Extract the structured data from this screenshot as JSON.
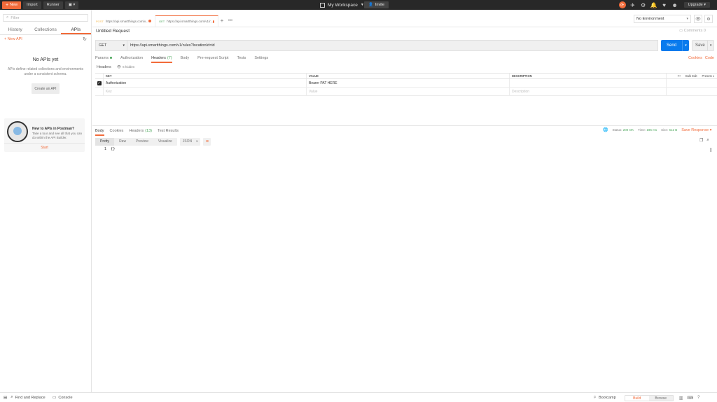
{
  "topbar": {
    "new_label": "New",
    "import_label": "Import",
    "runner_label": "Runner",
    "workspace_label": "My Workspace",
    "invite_label": "Invite",
    "upgrade_label": "Upgrade"
  },
  "sidebar": {
    "filter_placeholder": "Filter",
    "tabs": [
      "History",
      "Collections",
      "APIs"
    ],
    "new_api_label": "+ New API",
    "empty_title": "No APIs yet",
    "empty_desc": "APIs define related collections and environments under a consistent schema.",
    "create_label": "Create an API",
    "promo_title": "New to APIs in Postman?",
    "promo_desc": "Take a tour and see all that you can do within the API Builder.",
    "promo_start": "Start"
  },
  "tabs": [
    {
      "method": "POST",
      "url": "https://api.smartthings.com/v..."
    },
    {
      "method": "GET",
      "url": "https://api.smartthings.com/v1/r..."
    }
  ],
  "environment": {
    "selected": "No Environment"
  },
  "request": {
    "title": "Untitled Request",
    "comments_label": "Comments 0",
    "method": "GET",
    "url": "https://api.smartthings.com/v1/rules?locationId=id",
    "send_label": "Send",
    "save_label": "Save",
    "tabs": {
      "params": "Params",
      "authorization": "Authorization",
      "headers": "Headers",
      "headers_count": "(7)",
      "body": "Body",
      "prerequest": "Pre-request Script",
      "tests": "Tests",
      "settings": "Settings"
    },
    "cookies_link": "Cookies",
    "code_link": "Code",
    "headers_sub": "Headers",
    "hidden_label": "6 hidden",
    "table": {
      "col_key": "KEY",
      "col_value": "VALUE",
      "col_desc": "DESCRIPTION",
      "bulk_edit": "Bulk Edit",
      "presets": "Presets",
      "row_key": "Authorization",
      "row_value": "Bearer PAT HERE",
      "ph_key": "Key",
      "ph_value": "Value",
      "ph_desc": "Description"
    }
  },
  "response": {
    "tabs": {
      "body": "Body",
      "cookies": "Cookies",
      "headers": "Headers",
      "headers_count": "(13)",
      "tests": "Test Results"
    },
    "status_label": "Status:",
    "status_value": "200 OK",
    "time_label": "Time:",
    "time_value": "196 ms",
    "size_label": "Size:",
    "size_value": "612 B",
    "save_response": "Save Response",
    "views": [
      "Pretty",
      "Raw",
      "Preview",
      "Visualize"
    ],
    "format": "JSON",
    "line_number": "1",
    "code": "{}"
  },
  "bottombar": {
    "find_replace": "Find and Replace",
    "console": "Console",
    "bootcamp": "Bootcamp",
    "build": "Build",
    "browse": "Browse"
  },
  "colors": {
    "accent": "#f26b3a",
    "send": "#097bed",
    "success": "#4aa65a",
    "topbar": "#282828"
  }
}
